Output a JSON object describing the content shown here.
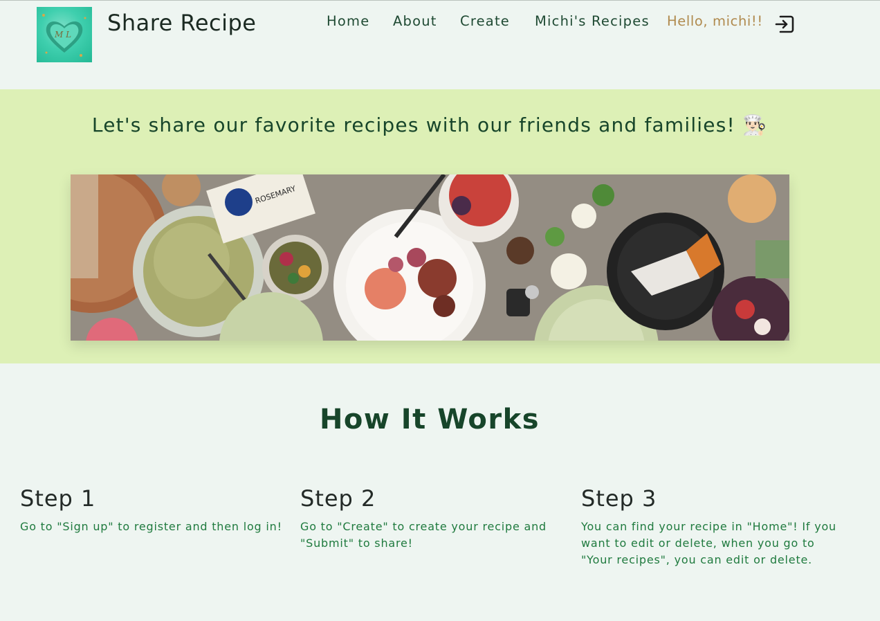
{
  "header": {
    "brand": "Share Recipe",
    "nav": [
      {
        "label": "Home"
      },
      {
        "label": "About"
      },
      {
        "label": "Create"
      },
      {
        "label": "Michi's Recipes"
      }
    ],
    "greeting": "Hello, michi!!",
    "logout_icon": "logout-icon"
  },
  "hero": {
    "tagline": "Let's share our favorite recipes with our friends and families! 👨🏻‍🍳"
  },
  "how": {
    "title": "How It Works",
    "steps": [
      {
        "title": "Step 1",
        "text": "Go to \"Sign up\" to register and then log in!"
      },
      {
        "title": "Step 2",
        "text": "Go to \"Create\" to create your recipe and \"Submit\" to share!"
      },
      {
        "title": "Step 3",
        "text": "You can find your recipe in \"Home\"! If you want to edit or delete, when you go to \"Your recipes\", you can edit or delete."
      }
    ]
  },
  "colors": {
    "page_bg": "#eef5f1",
    "hero_bg": "#ddf0b6",
    "heading": "#17452a",
    "step_text": "#1f7a3e",
    "greeting": "#b08a4e"
  }
}
